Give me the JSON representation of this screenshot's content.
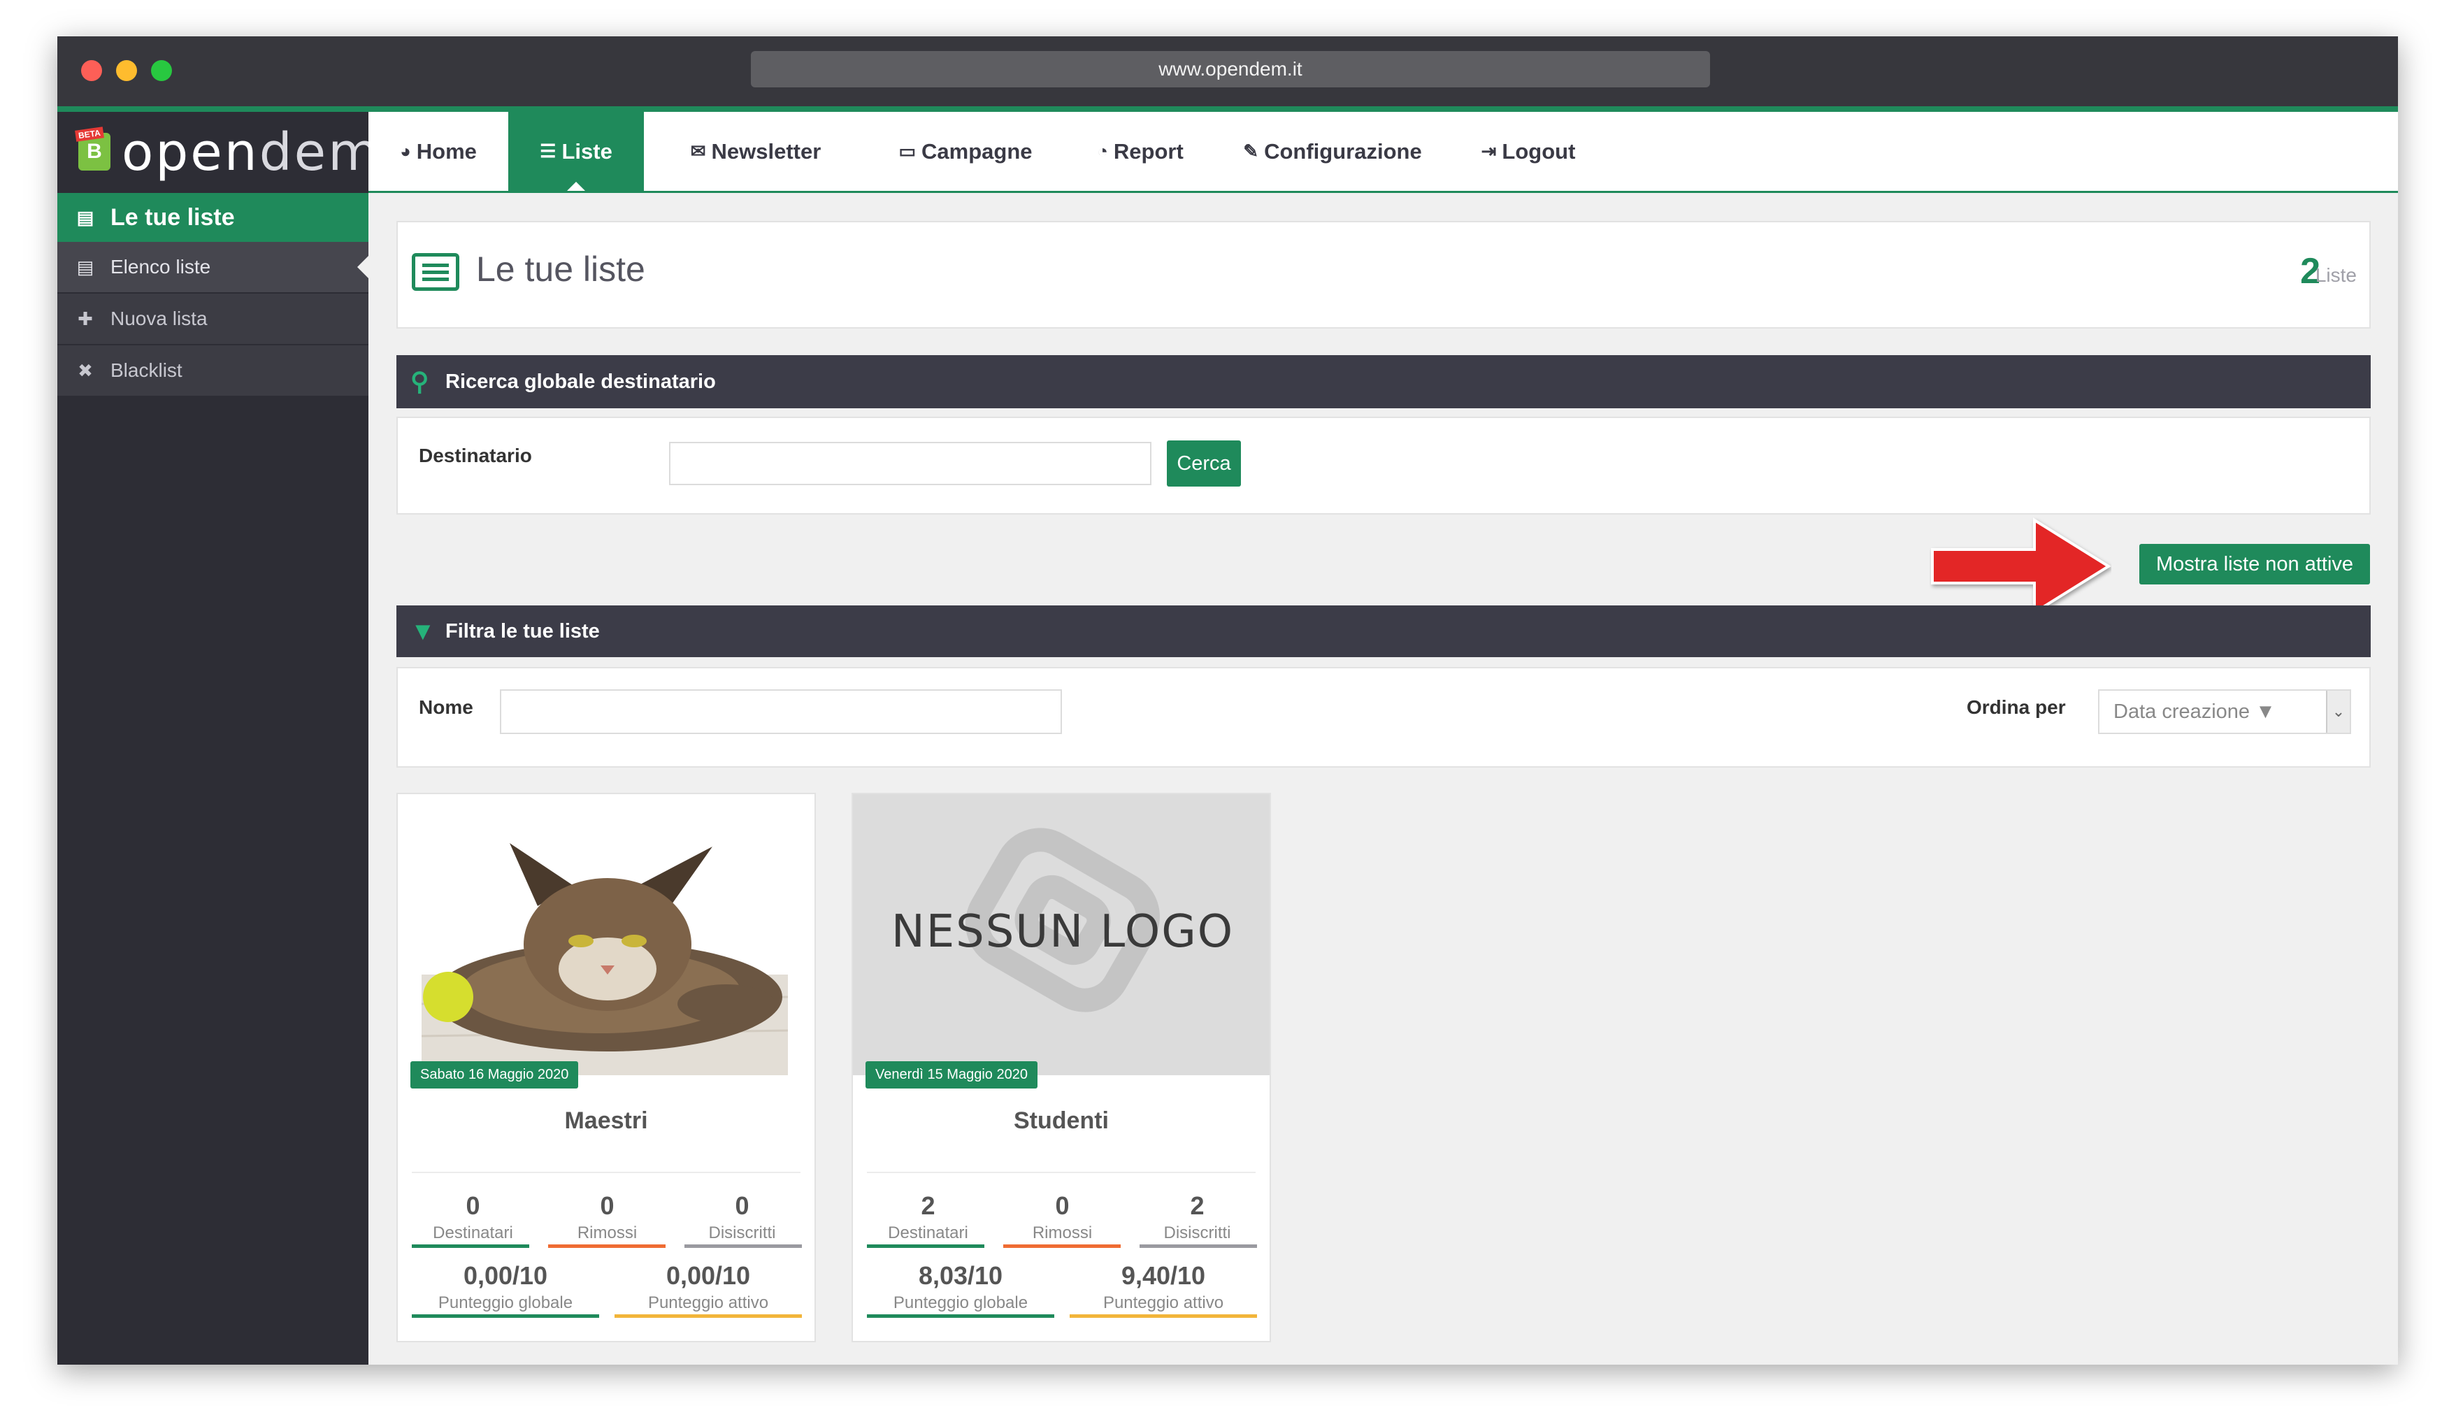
{
  "browser": {
    "url": "www.opendem.it"
  },
  "logo": {
    "badge": "B",
    "beta": "BETA",
    "text_open": "open",
    "text_dem": "dem"
  },
  "nav": {
    "items": [
      {
        "label": "Home",
        "icon": "dashboard-icon"
      },
      {
        "label": "Liste",
        "icon": "list-icon",
        "active": true
      },
      {
        "label": "Newsletter",
        "icon": "envelope-icon"
      },
      {
        "label": "Campagne",
        "icon": "folder-icon"
      },
      {
        "label": "Report",
        "icon": "pie-chart-icon"
      },
      {
        "label": "Configurazione",
        "icon": "wrench-icon"
      },
      {
        "label": "Logout",
        "icon": "sign-out-icon"
      }
    ]
  },
  "sidebar": {
    "header": "Le tue liste",
    "items": [
      {
        "label": "Elenco liste",
        "icon": "list-icon"
      },
      {
        "label": "Nuova lista",
        "icon": "plus-icon"
      },
      {
        "label": "Blacklist",
        "icon": "user-block-icon"
      }
    ]
  },
  "page": {
    "title": "Le tue liste",
    "count": "2",
    "count_label": "Liste"
  },
  "search": {
    "bar_title": "Ricerca globale destinatario",
    "field_label": "Destinatario",
    "value": "",
    "button": "Cerca"
  },
  "show_inactive_button": "Mostra liste non attive",
  "filter": {
    "bar_title": "Filtra le tue liste",
    "name_label": "Nome",
    "name_value": "",
    "order_label": "Ordina per",
    "order_value": "Data creazione ▼"
  },
  "cards": [
    {
      "name": "Maestri",
      "date": "Sabato 16 Maggio 2020",
      "image": "cat-photo",
      "destinatari": "0",
      "destinatari_label": "Destinatari",
      "rimossi": "0",
      "rimossi_label": "Rimossi",
      "disiscritti": "0",
      "disiscritti_label": "Disiscritti",
      "punteggio_globale": "0,00/10",
      "punteggio_globale_label": "Punteggio globale",
      "punteggio_attivo": "0,00/10",
      "punteggio_attivo_label": "Punteggio attivo"
    },
    {
      "name": "Studenti",
      "date": "Venerdì 15 Maggio 2020",
      "image": "nessun-logo",
      "logo_text": "NESSUN LOGO",
      "destinatari": "2",
      "destinatari_label": "Destinatari",
      "rimossi": "0",
      "rimossi_label": "Rimossi",
      "disiscritti": "2",
      "disiscritti_label": "Disiscritti",
      "punteggio_globale": "8,03/10",
      "punteggio_globale_label": "Punteggio globale",
      "punteggio_attivo": "9,40/10",
      "punteggio_attivo_label": "Punteggio attivo"
    }
  ],
  "colors": {
    "brand": "#1f8a5b",
    "sidebar": "#2d2d35",
    "bar": "#3c3c48",
    "rimossi": "#ef6c33",
    "attivo": "#f2b53a",
    "arrow": "#e32626"
  }
}
